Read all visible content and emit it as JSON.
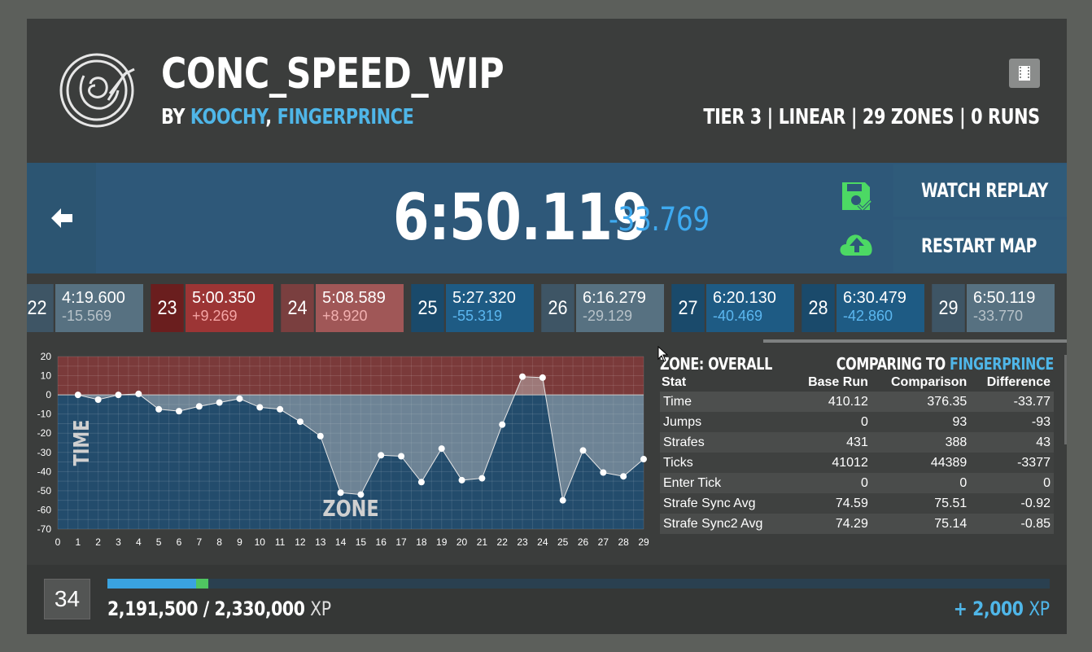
{
  "header": {
    "map_name": "CONC_SPEED_WIP",
    "by_prefix": "BY",
    "authors": [
      "KOOCHY",
      "FINGERPRINCE"
    ],
    "author_sep": ",",
    "info": "TIER 3 | LINEAR | 29 ZONES | 0 RUNS",
    "logo_icon": "momentum-mod-logo",
    "film_icon": "film-icon"
  },
  "result": {
    "time": "6:50.119",
    "diff": "-33.769",
    "watch_replay": "WATCH REPLAY",
    "restart_map": "RESTART MAP",
    "accent_blue": "#3eaaf0",
    "accent_green": "#4cd964"
  },
  "zones": [
    {
      "num": "22",
      "time": "4:19.600",
      "diff": "-15.569",
      "style": "slate"
    },
    {
      "num": "23",
      "time": "5:00.350",
      "diff": "+9.269",
      "style": "red"
    },
    {
      "num": "24",
      "time": "5:08.589",
      "diff": "+8.920",
      "style": "red2"
    },
    {
      "num": "25",
      "time": "5:27.320",
      "diff": "-55.319",
      "style": "blue"
    },
    {
      "num": "26",
      "time": "6:16.279",
      "diff": "-29.129",
      "style": "slate"
    },
    {
      "num": "27",
      "time": "6:20.130",
      "diff": "-40.469",
      "style": "blue"
    },
    {
      "num": "28",
      "time": "6:30.479",
      "diff": "-42.860",
      "style": "blue"
    },
    {
      "num": "29",
      "time": "6:50.119",
      "diff": "-33.770",
      "style": "slate"
    }
  ],
  "chart_data": {
    "type": "line",
    "xlabel": "ZONE",
    "ylabel": "TIME",
    "x": [
      0,
      1,
      2,
      3,
      4,
      5,
      6,
      7,
      8,
      9,
      10,
      11,
      12,
      13,
      14,
      15,
      16,
      17,
      18,
      19,
      20,
      21,
      22,
      23,
      24,
      25,
      26,
      27,
      28,
      29
    ],
    "y": [
      null,
      0,
      -2.5,
      0,
      0.5,
      -7.5,
      -8.5,
      -6,
      -4,
      -2,
      -6.5,
      -7.5,
      -14,
      -21.5,
      -51,
      -52,
      -31.5,
      -32,
      -45.5,
      -28,
      -44.5,
      -43.5,
      -15.5,
      9.5,
      9,
      -55,
      -29,
      -40.5,
      -42.5,
      -33.5
    ],
    "xlim": [
      0,
      29
    ],
    "ylim": [
      -70,
      20
    ],
    "yticks": [
      20,
      10,
      0,
      -10,
      -20,
      -30,
      -40,
      -50,
      -60,
      -70
    ],
    "grid": true
  },
  "stats": {
    "zone_label": "ZONE: OVERALL",
    "comparing_prefix": "COMPARING TO",
    "comparing_name": "FINGERPRINCE",
    "columns": [
      "Stat",
      "Base Run",
      "Comparison",
      "Difference"
    ],
    "rows": [
      [
        "Time",
        "410.12",
        "376.35",
        "-33.77"
      ],
      [
        "Jumps",
        "0",
        "93",
        "-93"
      ],
      [
        "Strafes",
        "431",
        "388",
        "43"
      ],
      [
        "Ticks",
        "41012",
        "44389",
        "-3377"
      ],
      [
        "Enter Tick",
        "0",
        "0",
        "0"
      ],
      [
        "Strafe Sync Avg",
        "74.59",
        "75.51",
        "-0.92"
      ],
      [
        "Strafe Sync2 Avg",
        "74.29",
        "75.14",
        "-0.85"
      ]
    ]
  },
  "footer": {
    "level": "34",
    "xp_current": "2,191,500",
    "xp_sep": "/",
    "xp_total": "2,330,000",
    "xp_unit": "XP",
    "xp_gain": "+ 2,000",
    "xp_progress": 0.094,
    "xp_gain_fraction": 0.013
  }
}
